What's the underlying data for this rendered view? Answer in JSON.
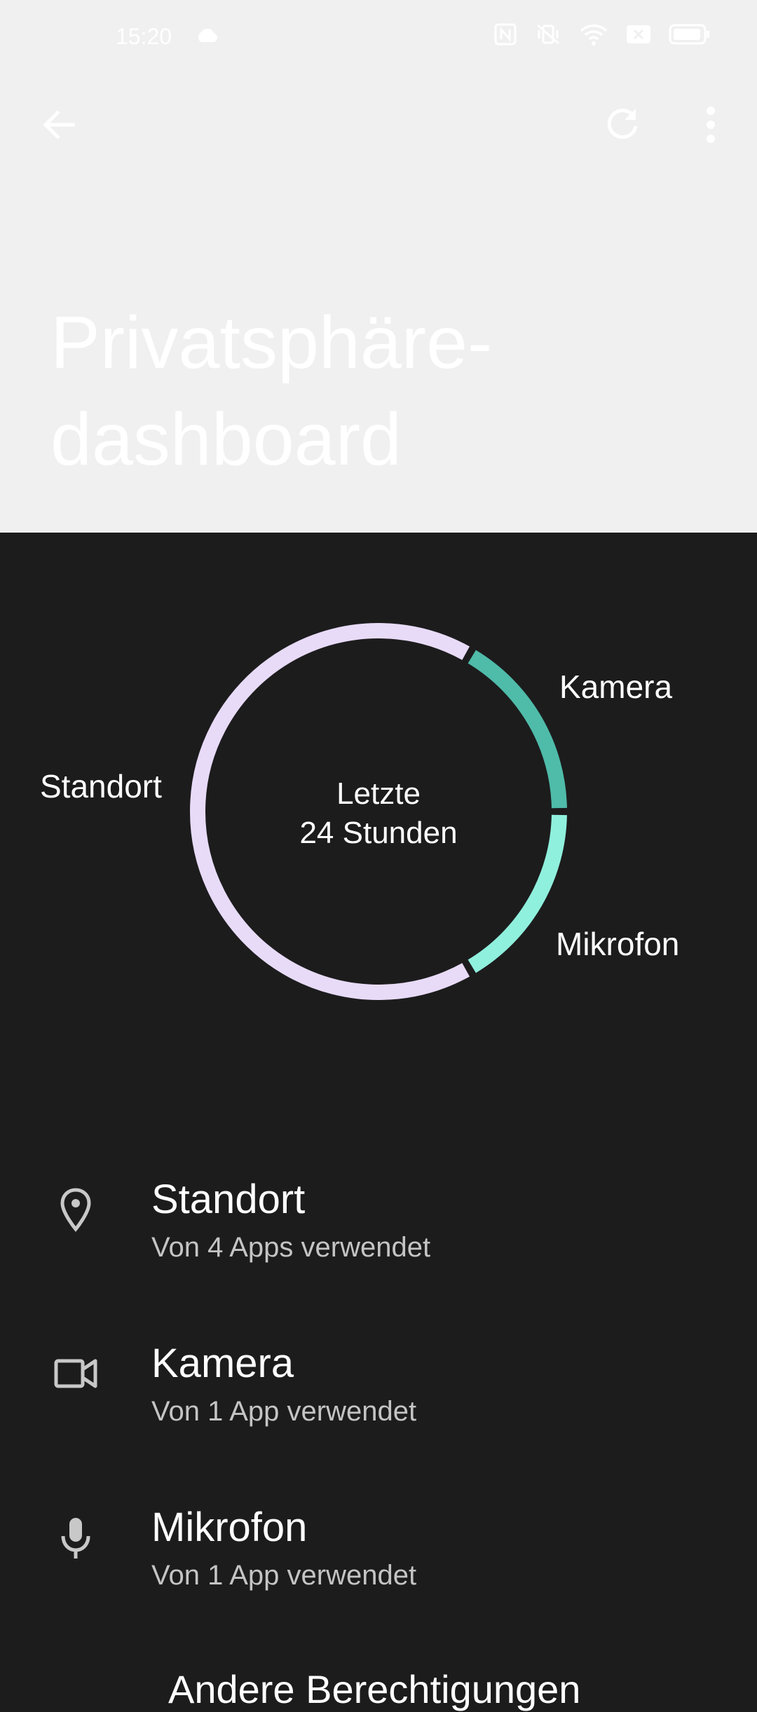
{
  "status_bar": {
    "time": "15:20",
    "icons": [
      "cloud-icon",
      "nfc-icon",
      "vibrate-off-icon",
      "wifi-icon",
      "sim-x-icon",
      "battery-icon"
    ]
  },
  "toolbar": {
    "back_icon": "arrow-back-icon",
    "refresh_icon": "refresh-icon",
    "more_icon": "more-vert-icon"
  },
  "page": {
    "title_line1": "Privatsphäre-",
    "title_line2": "dashboard"
  },
  "chart_data": {
    "type": "pie",
    "center_label_line1": "Letzte",
    "center_label_line2": "24 Stunden",
    "segments": [
      {
        "name": "Standort",
        "value": 4,
        "color": "#e8dbf8"
      },
      {
        "name": "Kamera",
        "value": 1,
        "color": "#4fbba9"
      },
      {
        "name": "Mikrofon",
        "value": 1,
        "color": "#8ff0dd"
      }
    ]
  },
  "permissions": [
    {
      "title": "Standort",
      "subtitle": "Von 4 Apps verwendet",
      "icon": "location-pin-icon"
    },
    {
      "title": "Kamera",
      "subtitle": "Von 1 App verwendet",
      "icon": "videocam-icon"
    },
    {
      "title": "Mikrofon",
      "subtitle": "Von 1 App verwendet",
      "icon": "mic-icon"
    }
  ],
  "other_permissions_heading": "Andere Berechtigungen",
  "colors": {
    "background": "#1c1c1d",
    "header_background": "#f0f0f0",
    "icon": "#c8c8c8"
  }
}
